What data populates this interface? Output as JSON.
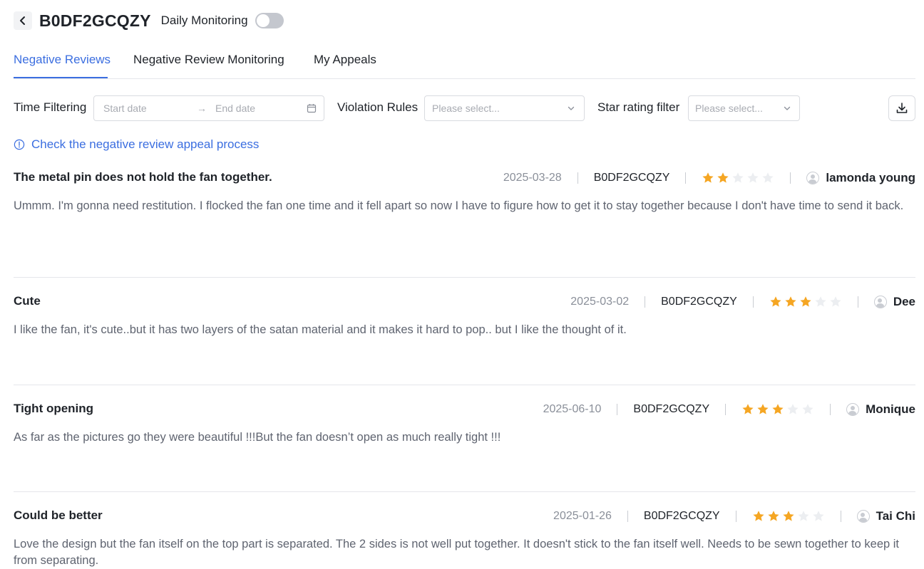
{
  "header": {
    "title": "B0DF2GCQZY",
    "monitoring_label": "Daily Monitoring",
    "monitoring_enabled": false
  },
  "tabs": [
    {
      "label": "Negative Reviews",
      "active": true
    },
    {
      "label": "Negative Review Monitoring",
      "active": false
    },
    {
      "label": "My Appeals",
      "active": false
    }
  ],
  "filters": {
    "time_label": "Time Filtering",
    "start_placeholder": "Start date",
    "end_placeholder": "End date",
    "range_arrow": "→",
    "violation_label": "Violation Rules",
    "violation_placeholder": "Please select...",
    "star_label": "Star rating filter",
    "star_placeholder": "Please select..."
  },
  "appeal_link": "Check the negative review appeal process",
  "colors": {
    "accent": "#3b6ee0",
    "star_filled": "#f5a623",
    "star_empty": "#eceef1"
  },
  "reviews": [
    {
      "title": "The metal pin does not hold the fan together.",
      "date": "2025-03-28",
      "asin": "B0DF2GCQZY",
      "rating": 2,
      "author": "lamonda young",
      "body": "Ummm. I'm gonna need restitution. I flocked the fan one time and it fell apart so now I have to figure how to get it to stay together because I don't have time to send it back."
    },
    {
      "title": "Cute",
      "date": "2025-03-02",
      "asin": "B0DF2GCQZY",
      "rating": 3,
      "author": "Dee",
      "body": "I like the fan, it's cute..but it has two layers of the satan material and it makes it hard to pop.. but I like the thought of it."
    },
    {
      "title": "Tight opening",
      "date": "2025-06-10",
      "asin": "B0DF2GCQZY",
      "rating": 3,
      "author": "Monique",
      "body": "As far as the pictures go they were beautiful !!!But the fan doesn’t open as much really tight !!!"
    },
    {
      "title": "Could be better",
      "date": "2025-01-26",
      "asin": "B0DF2GCQZY",
      "rating": 3,
      "author": "Tai Chi",
      "body": "Love the design but the fan itself on the top part is separated. The 2 sides is not well put together. It doesn't stick to the fan itself well. Needs to be sewn together to keep it from separating."
    }
  ]
}
